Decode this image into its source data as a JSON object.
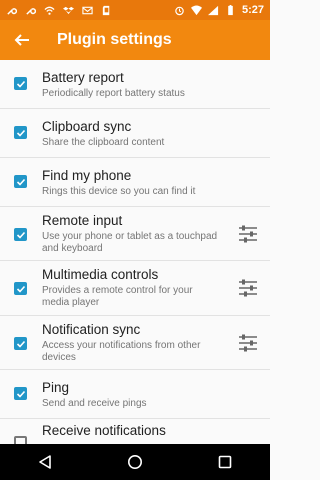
{
  "status": {
    "time": "5:27",
    "left_icons": [
      "wrench-icon",
      "wrench-icon",
      "wifi-icon",
      "dropbox-icon",
      "mail-icon",
      "sd-card-icon"
    ],
    "right_icons": [
      "alarm-icon",
      "wifi-signal-icon",
      "cell-signal-icon",
      "battery-icon"
    ]
  },
  "app_bar": {
    "title": "Plugin settings",
    "back_icon": "arrow-back-icon"
  },
  "colors": {
    "status_bar": "#e8780c",
    "app_bar": "#f2880f",
    "checkbox": "#2196c8"
  },
  "plugins": [
    {
      "title": "Battery report",
      "subtitle": "Periodically report battery status",
      "checked": true,
      "has_settings": false
    },
    {
      "title": "Clipboard sync",
      "subtitle": "Share the clipboard content",
      "checked": true,
      "has_settings": false
    },
    {
      "title": "Find my phone",
      "subtitle": "Rings this device so you can find it",
      "checked": true,
      "has_settings": false
    },
    {
      "title": "Remote input",
      "subtitle": "Use your phone or tablet as a touchpad and keyboard",
      "checked": true,
      "has_settings": true
    },
    {
      "title": "Multimedia controls",
      "subtitle": "Provides a remote control for your media player",
      "checked": true,
      "has_settings": true
    },
    {
      "title": "Notification sync",
      "subtitle": "Access your notifications from other devices",
      "checked": true,
      "has_settings": true
    },
    {
      "title": "Ping",
      "subtitle": "Send and receive pings",
      "checked": true,
      "has_settings": false
    },
    {
      "title": "Receive notifications",
      "subtitle": "",
      "checked": false,
      "has_settings": false
    }
  ],
  "nav": {
    "back_icon": "nav-back-icon",
    "home_icon": "nav-home-icon",
    "recents_icon": "nav-recents-icon"
  }
}
